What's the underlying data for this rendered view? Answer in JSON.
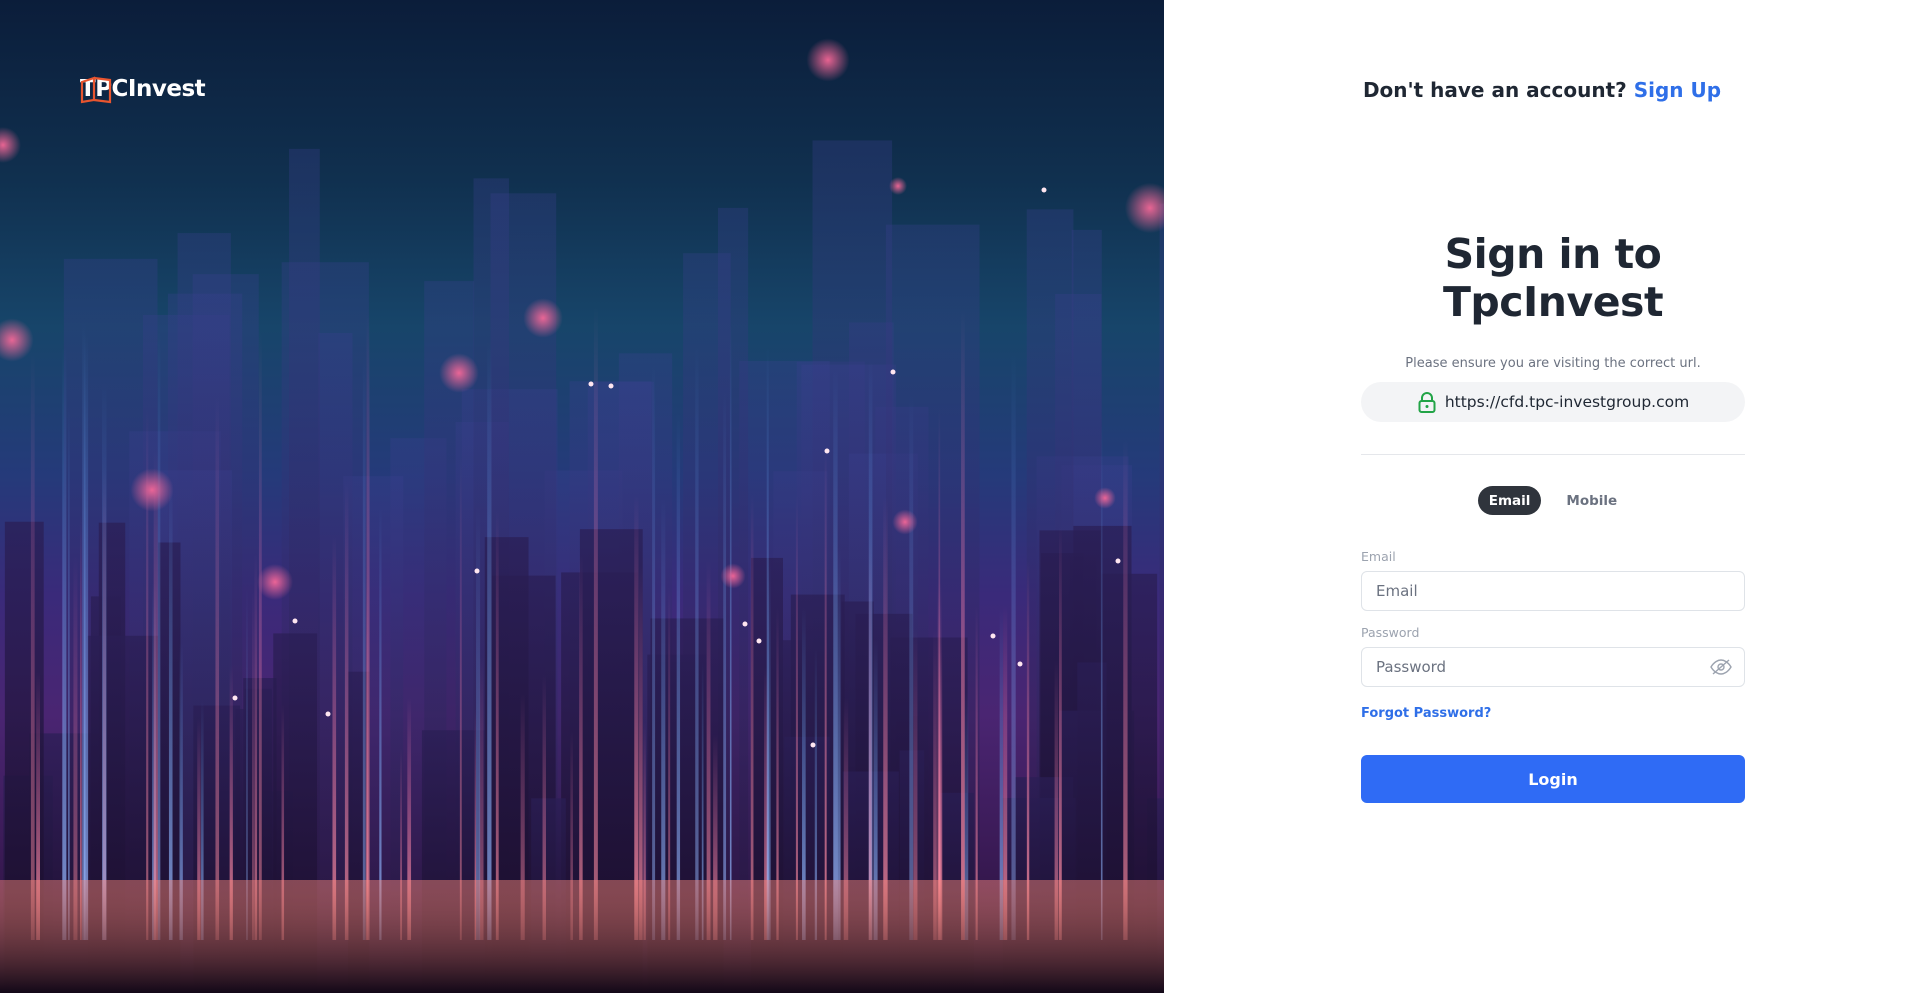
{
  "brand": {
    "name": "TPCInvest",
    "logo_icon": "book-outline-icon",
    "logo_color": "#e8552f"
  },
  "header": {
    "prompt": "Don't have an account?",
    "signup_label": "Sign Up"
  },
  "form": {
    "title": "Sign in to TpcInvest",
    "notice": "Please ensure you are visiting the correct url.",
    "url": "https://cfd.tpc-investgroup.com",
    "url_icon": "lock-icon",
    "tabs": [
      {
        "label": "Email",
        "active": true
      },
      {
        "label": "Mobile",
        "active": false
      }
    ],
    "email_label": "Email",
    "email_placeholder": "Email",
    "password_label": "Password",
    "password_placeholder": "Password",
    "password_toggle_icon": "eye-off-icon",
    "forgot_label": "Forgot Password?",
    "login_label": "Login"
  },
  "colors": {
    "accent": "#2f6bf5",
    "link": "#2f6fe8",
    "text": "#1f2733",
    "tab_active": "#2f343c"
  }
}
